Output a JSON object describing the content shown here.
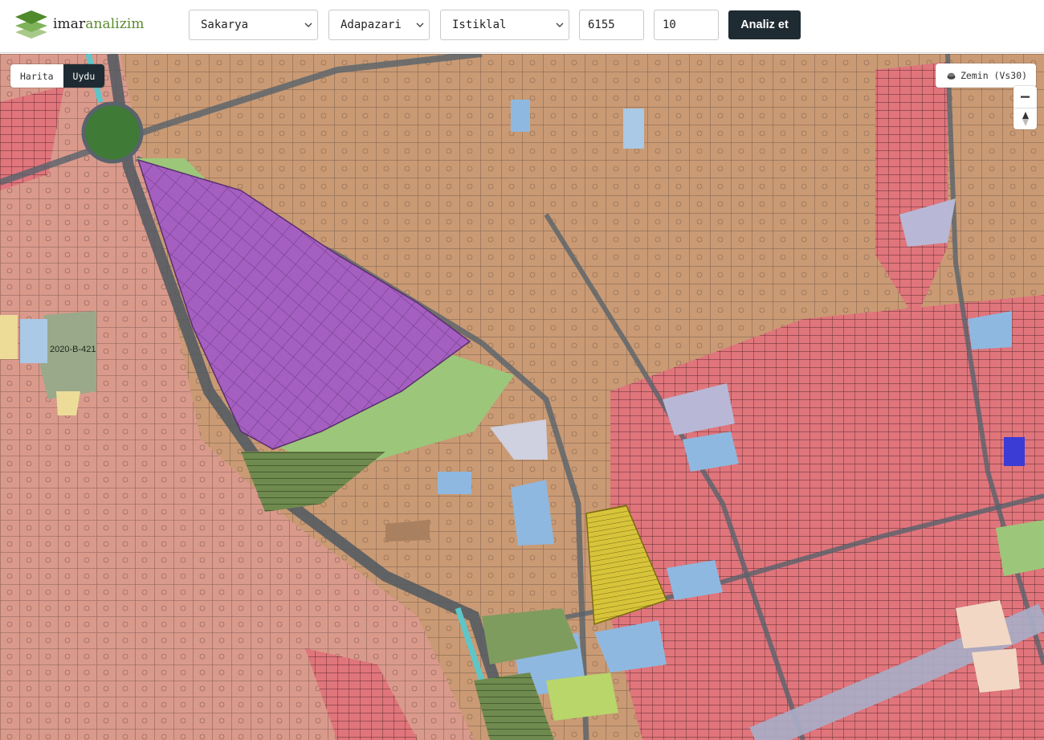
{
  "brand": {
    "part1": "imar",
    "part2": "analizim"
  },
  "form": {
    "province": "Sakarya",
    "district": "Adapazari",
    "neighborhood": "Istiklal",
    "block": "6155",
    "parcel": "10",
    "submit_label": "Analiz et"
  },
  "map": {
    "toggle": {
      "map_label": "Harita",
      "satellite_label": "Uydu",
      "active": "Uydu"
    },
    "layer_label": "Zemin (Vs30)",
    "plan_labels": [
      "2020-B-421"
    ]
  },
  "colors": {
    "accent": "#1f2b33",
    "brand_green": "#5a8a2e",
    "residential_tan": "#c99a74",
    "commercial_red": "#e0757c",
    "park_green": "#9cc77a",
    "school_blue": "#8fb8e0",
    "public_purple": "#a45fc0",
    "industry_yellow": "#d8c43a"
  }
}
